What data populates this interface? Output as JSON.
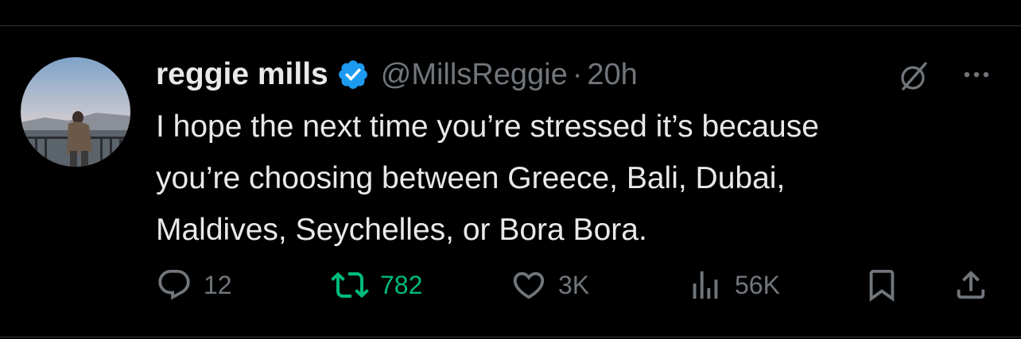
{
  "tweet": {
    "display_name": "reggie mills",
    "handle": "@MillsReggie",
    "separator": "·",
    "time": "20h",
    "text": "I hope the next time you’re stressed it’s because\nyou’re choosing between Greece, Bali, Dubai,\nMaldives, Seychelles, or Bora Bora.",
    "verified": true
  },
  "actions": {
    "replies": "12",
    "reposts": "782",
    "likes": "3K",
    "views": "56K"
  },
  "icons": {
    "reply": "reply-icon",
    "repost": "repost-icon",
    "like": "heart-icon",
    "views": "views-chart-icon",
    "bookmark": "bookmark-icon",
    "share": "share-icon",
    "grok": "grok-icon",
    "more": "more-icon",
    "verified": "verified-badge-icon"
  },
  "colors": {
    "background": "#000000",
    "text": "#e7e9ea",
    "secondary": "#71767b",
    "verified": "#1d9bf0",
    "repost_active": "#00ba7c",
    "divider": "#2f3336"
  }
}
